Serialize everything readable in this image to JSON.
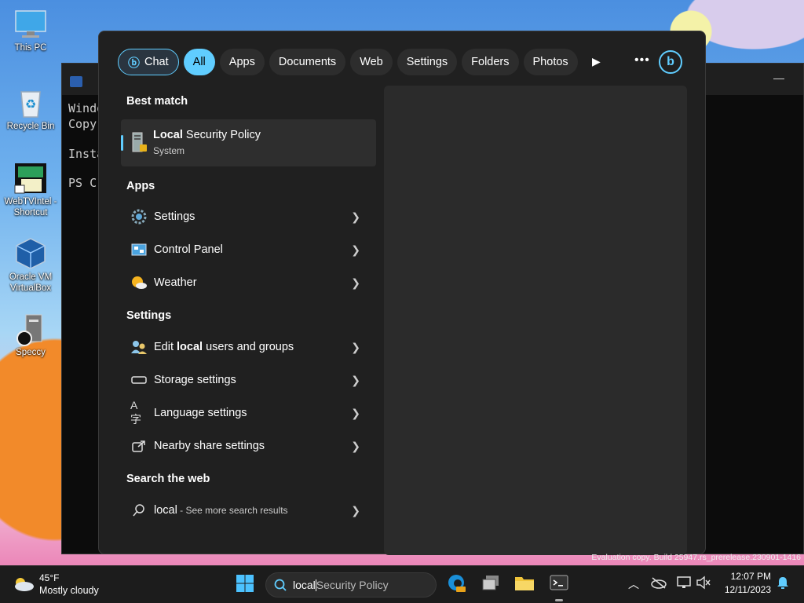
{
  "desktop": {
    "icons": [
      {
        "label": "This PC"
      },
      {
        "label": "Recycle Bin"
      },
      {
        "label": "WebTVIntel - Shortcut"
      },
      {
        "label": "Oracle VM VirtualBox"
      },
      {
        "label": "Speccy"
      }
    ],
    "watermark": "Evaluation copy. Build 25947.rs_prerelease.230901-1416"
  },
  "terminal": {
    "lines": [
      "Windo",
      "Copyr",
      "",
      "Insta",
      "",
      "PS C"
    ]
  },
  "search_panel": {
    "chips": [
      "Chat",
      "All",
      "Apps",
      "Documents",
      "Web",
      "Settings",
      "Folders",
      "Photos"
    ],
    "active_chip": "All",
    "best_match": {
      "header": "Best match",
      "title_bold": "Local",
      "title_rest": " Security Policy",
      "subtitle": "System"
    },
    "apps": {
      "header": "Apps",
      "items": [
        "Settings",
        "Control Panel",
        "Weather"
      ]
    },
    "settings": {
      "header": "Settings",
      "items": [
        {
          "pre": "Edit ",
          "bold": "local",
          "post": " users and groups"
        },
        {
          "pre": "Storage settings",
          "bold": "",
          "post": ""
        },
        {
          "pre": "Language settings",
          "bold": "",
          "post": ""
        },
        {
          "pre": "Nearby share settings",
          "bold": "",
          "post": ""
        }
      ]
    },
    "web": {
      "header": "Search the web",
      "query": "local",
      "suffix": " - See more search results"
    }
  },
  "taskbar": {
    "weather_temp": "45°F",
    "weather_desc": "Mostly cloudy",
    "search_typed": "local",
    "search_suggest": "Security Policy",
    "time": "12:07 PM",
    "date": "12/11/2023"
  },
  "colors": {
    "accent": "#60cdff",
    "panel": "#202020"
  }
}
